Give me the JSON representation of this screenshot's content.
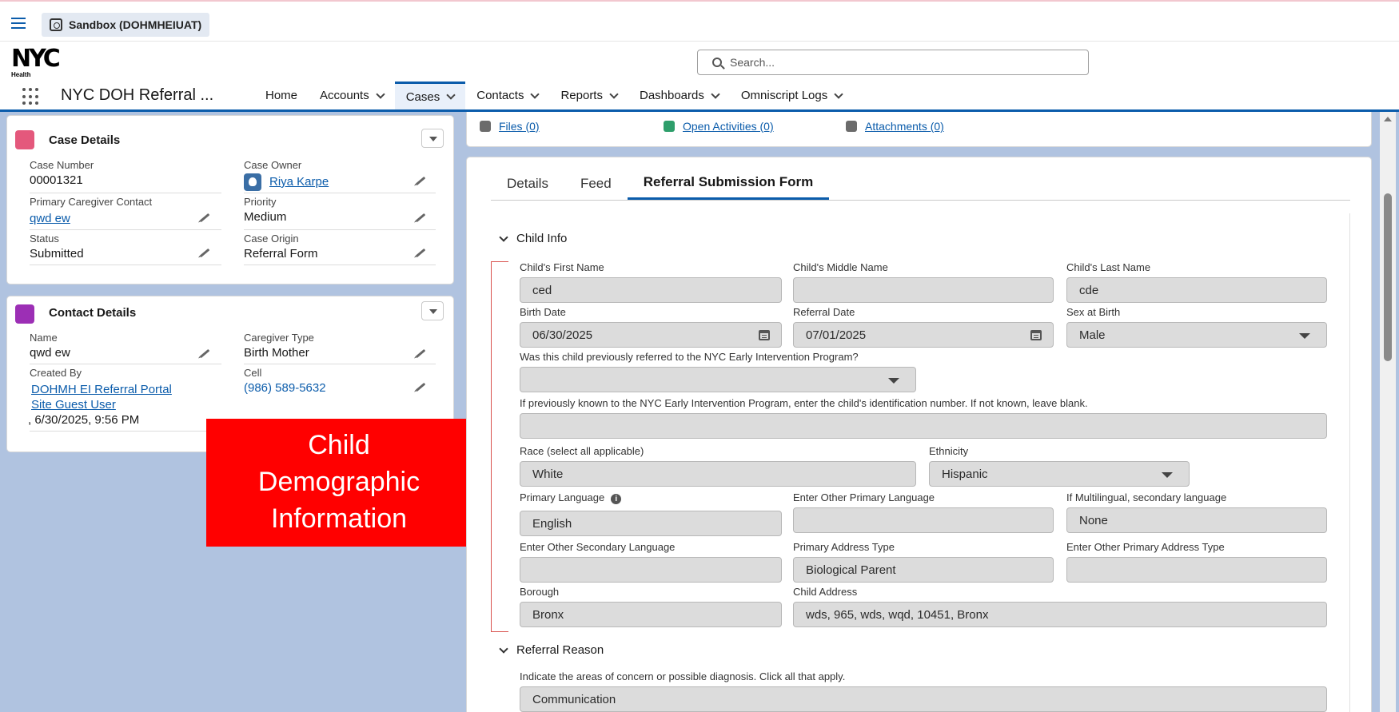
{
  "sandbox": {
    "label": "Sandbox (DOHMHEIUAT)"
  },
  "header": {
    "logo": "NYC",
    "logo_sub": "Health",
    "search_placeholder": "Search...",
    "app_name": "NYC DOH Referral ...",
    "nav": [
      {
        "label": "Home"
      },
      {
        "label": "Accounts"
      },
      {
        "label": "Cases"
      },
      {
        "label": "Contacts"
      },
      {
        "label": "Reports"
      },
      {
        "label": "Dashboards"
      },
      {
        "label": "Omniscript Logs"
      }
    ]
  },
  "case_details": {
    "title": "Case Details",
    "case_number_label": "Case Number",
    "case_number": "00001321",
    "case_owner_label": "Case Owner",
    "case_owner": "Riya Karpe",
    "primary_contact_label": "Primary Caregiver Contact",
    "primary_contact": "qwd ew",
    "priority_label": "Priority",
    "priority": "Medium",
    "status_label": "Status",
    "status": "Submitted",
    "origin_label": "Case Origin",
    "origin": "Referral Form"
  },
  "contact_details": {
    "title": "Contact Details",
    "name_label": "Name",
    "name": "qwd ew",
    "caregiver_type_label": "Caregiver Type",
    "caregiver_type": "Birth Mother",
    "created_by_label": "Created By",
    "created_by_line1": "DOHMH EI Referral Portal",
    "created_by_line2": "Site Guest User",
    "created_at": ", 6/30/2025, 9:56 PM",
    "cell_label": "Cell",
    "cell": "(986) 589-5632"
  },
  "overlay_label": [
    "Child",
    "Demographic",
    "Information"
  ],
  "related": {
    "files": "Files (0)",
    "activities": "Open Activities (0)",
    "attachments": "Attachments (0)"
  },
  "tabs": [
    "Details",
    "Feed",
    "Referral Submission Form"
  ],
  "form": {
    "child_info_title": "Child Info",
    "first_name_label": "Child's First Name",
    "first_name": "ced",
    "middle_name_label": "Child's Middle Name",
    "middle_name": "",
    "last_name_label": "Child's Last Name",
    "last_name": "cde",
    "birth_date_label": "Birth Date",
    "birth_date": "06/30/2025",
    "referral_date_label": "Referral Date",
    "referral_date": "07/01/2025",
    "sex_label": "Sex at Birth",
    "sex": "Male",
    "prev_referred_label": "Was this child previously referred to the NYC Early Intervention Program?",
    "prev_referred": "",
    "id_number_label": "If previously known to the NYC Early Intervention Program, enter the child's identification number. If not known, leave blank.",
    "id_number": "",
    "race_label": "Race (select all applicable)",
    "race": "White",
    "ethnicity_label": "Ethnicity",
    "ethnicity": "Hispanic",
    "primary_lang_label": "Primary Language",
    "primary_lang": "English",
    "other_primary_lang_label": "Enter Other Primary Language",
    "other_primary_lang": "",
    "secondary_lang_label": "If Multilingual, secondary language",
    "secondary_lang": "None",
    "other_secondary_lang_label": "Enter Other Secondary Language",
    "other_secondary_lang": "",
    "address_type_label": "Primary Address Type",
    "address_type": "Biological Parent",
    "other_address_type_label": "Enter Other Primary Address Type",
    "other_address_type": "",
    "borough_label": "Borough",
    "borough": "Bronx",
    "child_address_label": "Child Address",
    "child_address": "wds, 965, wds, wqd, 10451, Bronx",
    "referral_reason_title": "Referral Reason",
    "concern_label": "Indicate the areas of concern or possible diagnosis. Click all that apply.",
    "concern": "Communication"
  },
  "colors": {
    "brand": "#0b5cab",
    "background": "#b0c3e0",
    "overlay": "#ff0000"
  }
}
